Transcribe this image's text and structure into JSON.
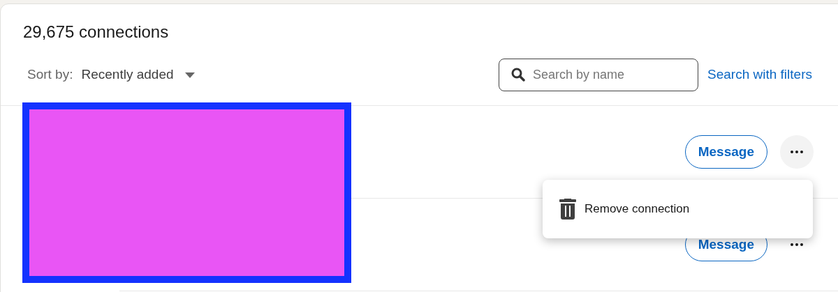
{
  "header": {
    "title": "29,675 connections",
    "sort_label": "Sort by:",
    "sort_value": "Recently added",
    "search": {
      "placeholder": "Search by name"
    },
    "filters_link": "Search with filters"
  },
  "rows": [
    {
      "action": "Message",
      "menu_open": true
    },
    {
      "action": "Message",
      "menu_open": false
    }
  ],
  "menu": {
    "items": [
      {
        "label": "Remove connection"
      }
    ]
  }
}
